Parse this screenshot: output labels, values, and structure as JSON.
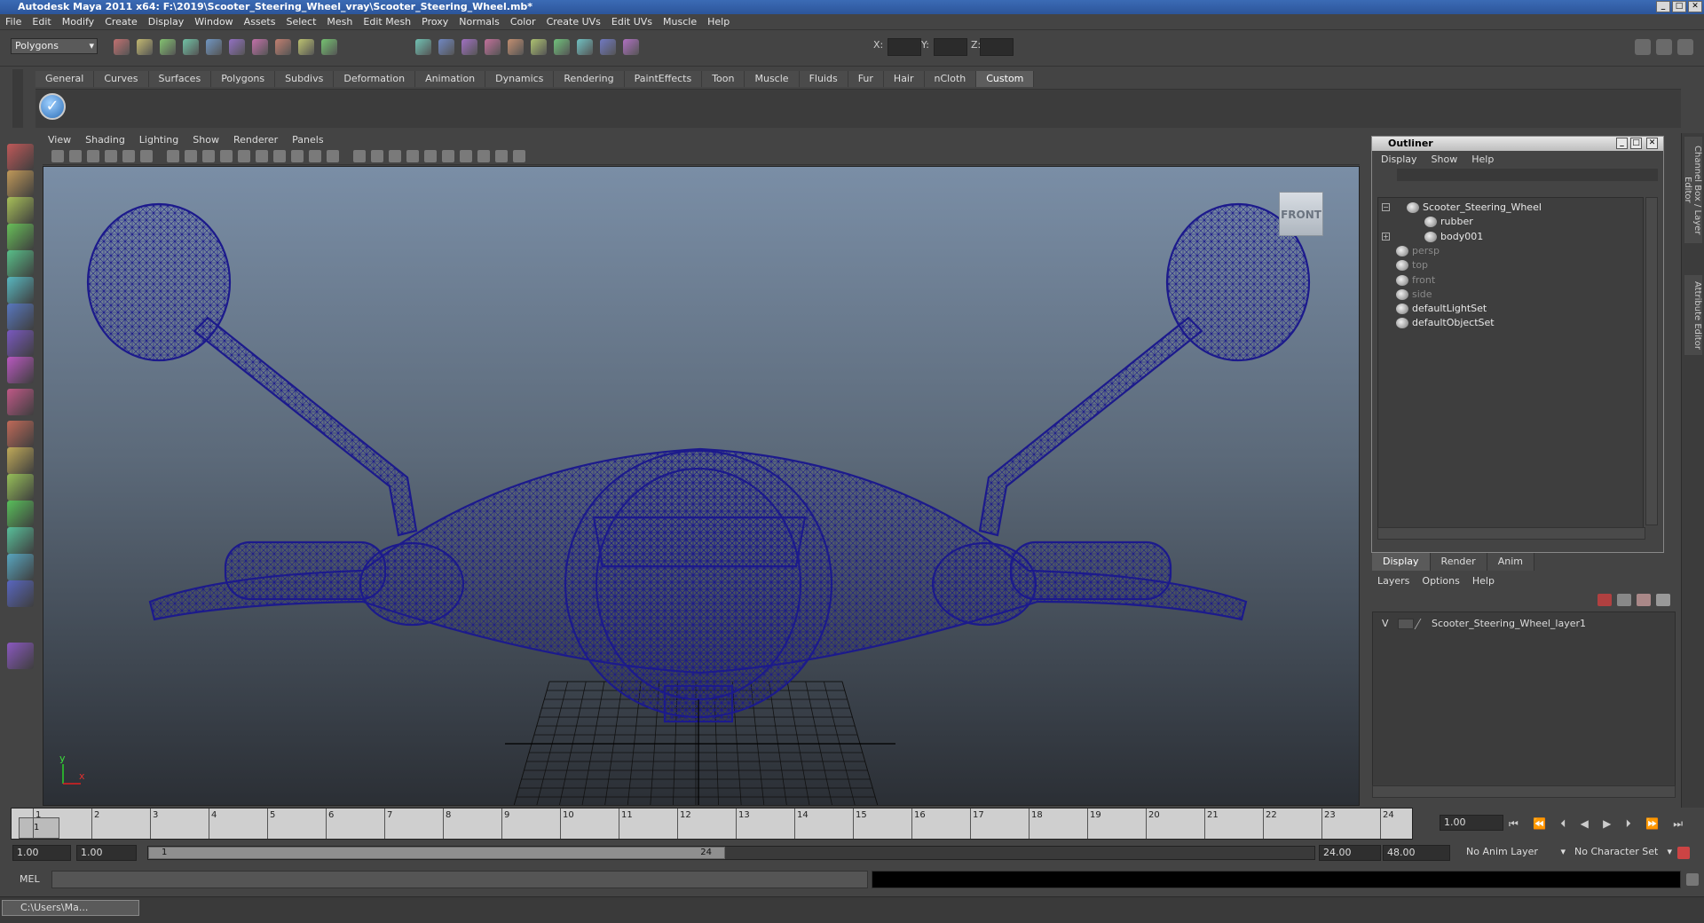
{
  "window": {
    "title": "Autodesk Maya 2011 x64: F:\\2019\\Scooter_Steering_Wheel_vray\\Scooter_Steering_Wheel.mb*",
    "min_icon": "minimize-icon",
    "max_icon": "maximize-icon",
    "close_icon": "close-icon"
  },
  "menubar": [
    "File",
    "Edit",
    "Modify",
    "Create",
    "Display",
    "Window",
    "Assets",
    "Select",
    "Mesh",
    "Edit Mesh",
    "Proxy",
    "Normals",
    "Color",
    "Create UVs",
    "Edit UVs",
    "Muscle",
    "Help"
  ],
  "statusline": {
    "mode": "Polygons",
    "x_label": "X:",
    "y_label": "Y:",
    "z_label": "Z:"
  },
  "shelf": {
    "tabs": [
      "General",
      "Curves",
      "Surfaces",
      "Polygons",
      "Subdivs",
      "Deformation",
      "Animation",
      "Dynamics",
      "Rendering",
      "PaintEffects",
      "Toon",
      "Muscle",
      "Fluids",
      "Fur",
      "Hair",
      "nCloth",
      "Custom"
    ],
    "active_tab": "Custom"
  },
  "viewport": {
    "menu": [
      "View",
      "Shading",
      "Lighting",
      "Show",
      "Renderer",
      "Panels"
    ],
    "viewcube_label": "FRONT",
    "axis_y": "y",
    "axis_x": "x",
    "wire_color": "#1c1a8c"
  },
  "outliner": {
    "title": "Outliner",
    "menu": [
      "Display",
      "Show",
      "Help"
    ],
    "items": [
      {
        "label": "Scooter_Steering_Wheel",
        "dim": false
      },
      {
        "label": "rubber",
        "dim": false
      },
      {
        "label": "body001",
        "dim": false
      },
      {
        "label": "persp",
        "dim": true
      },
      {
        "label": "top",
        "dim": true
      },
      {
        "label": "front",
        "dim": true
      },
      {
        "label": "side",
        "dim": true
      },
      {
        "label": "defaultLightSet",
        "dim": false
      },
      {
        "label": "defaultObjectSet",
        "dim": false
      }
    ]
  },
  "layer_editor": {
    "tabs": [
      "Display",
      "Render",
      "Anim"
    ],
    "active_tab": "Display",
    "menu": [
      "Layers",
      "Options",
      "Help"
    ],
    "layers": [
      {
        "visibility": "V",
        "name": "Scooter_Steering_Wheel_layer1"
      }
    ]
  },
  "side_tabs": [
    "Channel Box / Layer Editor",
    "Attribute Editor"
  ],
  "timeline": {
    "ticks": [
      "1",
      "2",
      "3",
      "4",
      "5",
      "6",
      "7",
      "8",
      "9",
      "10",
      "11",
      "12",
      "13",
      "14",
      "15",
      "16",
      "17",
      "18",
      "19",
      "20",
      "21",
      "22",
      "23",
      "24"
    ],
    "current_marker": "1",
    "current_frame": "1.00"
  },
  "range": {
    "start": "1.00",
    "inner_start": "1.00",
    "thumb_start": "1",
    "thumb_end": "24",
    "end": "24.00",
    "outer_end": "48.00",
    "anim_layer": "No Anim Layer",
    "character_set": "No Character Set"
  },
  "cmdline": {
    "label": "MEL"
  },
  "taskbar": {
    "item": "C:\\Users\\Ma..."
  }
}
